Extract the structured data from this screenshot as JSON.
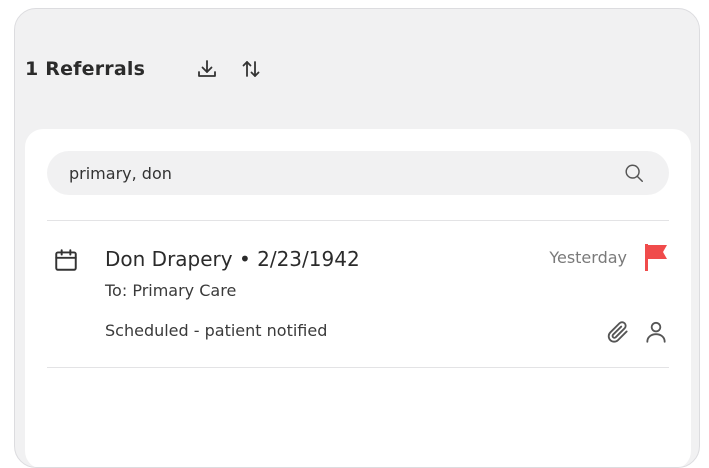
{
  "header": {
    "title": "1 Referrals",
    "download_icon": "download-icon",
    "sort_icon": "sort-arrows-icon"
  },
  "search": {
    "value": "primary, don",
    "icon": "search-icon"
  },
  "referrals": [
    {
      "name_line": "Don Drapery • 2/23/1942",
      "to": "To: Primary Care",
      "status": "Scheduled - patient notified",
      "date": "Yesterday",
      "flag_color": "#f04b4b",
      "icons": [
        "calendar-icon",
        "flag-icon",
        "paperclip-icon",
        "person-icon"
      ]
    }
  ],
  "colors": {
    "panel_bg": "#f1f1f2",
    "card_bg": "#ffffff",
    "flag": "#f04b4b"
  }
}
